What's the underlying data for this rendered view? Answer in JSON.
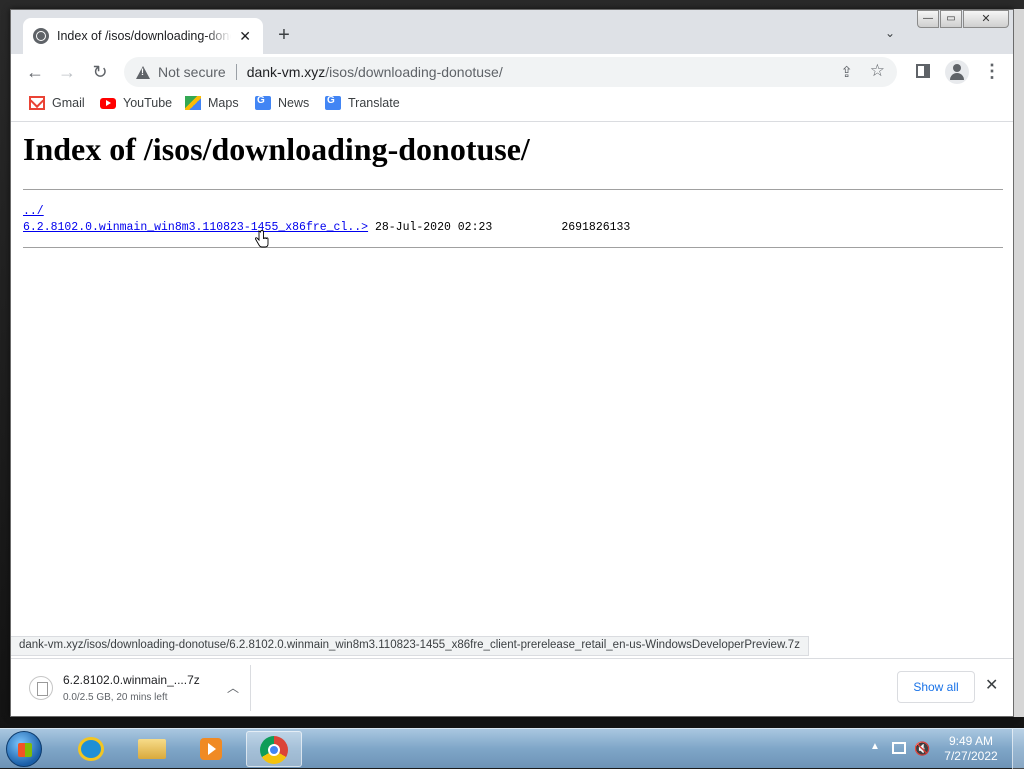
{
  "browser": {
    "tab": {
      "title": "Index of /isos/downloading-donotuse/"
    },
    "omnibox": {
      "security": "Not secure",
      "host": "dank-vm.xyz",
      "path": "/isos/downloading-donotuse/"
    },
    "bookmarks": [
      {
        "label": "Gmail",
        "icon": "gmail-icon"
      },
      {
        "label": "YouTube",
        "icon": "youtube-icon"
      },
      {
        "label": "Maps",
        "icon": "maps-icon"
      },
      {
        "label": "News",
        "icon": "news-icon"
      },
      {
        "label": "Translate",
        "icon": "translate-icon"
      }
    ]
  },
  "page": {
    "heading": "Index of /isos/downloading-donotuse/",
    "parent_link": "../",
    "entries": [
      {
        "name": "6.2.8102.0.winmain_win8m3.110823-1455_x86fre_cl..>",
        "date": "28-Jul-2020 02:23",
        "size": "2691826133"
      }
    ]
  },
  "status_bar": "dank-vm.xyz/isos/downloading-donotuse/6.2.8102.0.winmain_win8m3.110823-1455_x86fre_client-prerelease_retail_en-us-WindowsDeveloperPreview.7z",
  "downloads": {
    "item": {
      "name": "6.2.8102.0.winmain_....7z",
      "status": "0.0/2.5 GB, 20 mins left"
    },
    "show_all": "Show all"
  },
  "taskbar": {
    "time": "9:49 AM",
    "date": "7/27/2022",
    "apps": [
      "internet-explorer-icon",
      "file-explorer-icon",
      "media-player-icon",
      "chrome-icon"
    ]
  }
}
